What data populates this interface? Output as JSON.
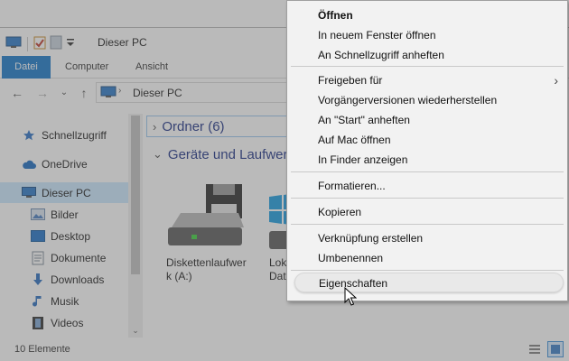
{
  "window": {
    "title": "Dieser PC",
    "ribbon_tabs": [
      "Datei",
      "Computer",
      "Ansicht"
    ],
    "address": "Dieser PC",
    "status": "10 Elemente",
    "colors": {
      "accent": "#1979ca",
      "group_header": "#1e3287",
      "selection": "#cce8ff"
    }
  },
  "navigation": {
    "items": [
      {
        "label": "Schnellzugriff",
        "icon": "star-icon"
      },
      {
        "label": "OneDrive",
        "icon": "cloud-icon"
      },
      {
        "label": "Dieser PC",
        "icon": "computer-icon",
        "selected": true
      },
      {
        "label": "Bilder",
        "icon": "pictures-folder-icon"
      },
      {
        "label": "Desktop",
        "icon": "desktop-folder-icon"
      },
      {
        "label": "Dokumente",
        "icon": "documents-folder-icon"
      },
      {
        "label": "Downloads",
        "icon": "download-arrow-icon"
      },
      {
        "label": "Musik",
        "icon": "music-note-icon"
      },
      {
        "label": "Videos",
        "icon": "film-icon"
      }
    ]
  },
  "content": {
    "groups": [
      {
        "label": "Ordner (6)",
        "expanded": false
      },
      {
        "label": "Geräte und Laufwerke",
        "expanded": true
      }
    ],
    "drives": [
      {
        "label_line1": "Diskettenlaufwer",
        "label_line2": "k (A:)",
        "icon": "floppy-drive-icon"
      },
      {
        "label_line1": "Lok",
        "label_line2": "Dat",
        "icon": "windows-drive-icon"
      }
    ]
  },
  "context_menu": {
    "items": [
      {
        "label": "Öffnen",
        "bold": true
      },
      {
        "label": "In neuem Fenster öffnen"
      },
      {
        "label": "An Schnellzugriff anheften"
      },
      {
        "separator": true
      },
      {
        "label": "Freigeben für",
        "submenu": true
      },
      {
        "label": "Vorgängerversionen wiederherstellen"
      },
      {
        "label": "An \"Start\" anheften"
      },
      {
        "label": "Auf Mac öffnen"
      },
      {
        "label": "In Finder anzeigen"
      },
      {
        "separator": true
      },
      {
        "label": "Formatieren..."
      },
      {
        "separator": true
      },
      {
        "label": "Kopieren"
      },
      {
        "separator": true
      },
      {
        "label": "Verknüpfung erstellen"
      },
      {
        "label": "Umbenennen"
      },
      {
        "separator": true
      },
      {
        "label": "Eigenschaften",
        "highlighted": true
      }
    ]
  }
}
